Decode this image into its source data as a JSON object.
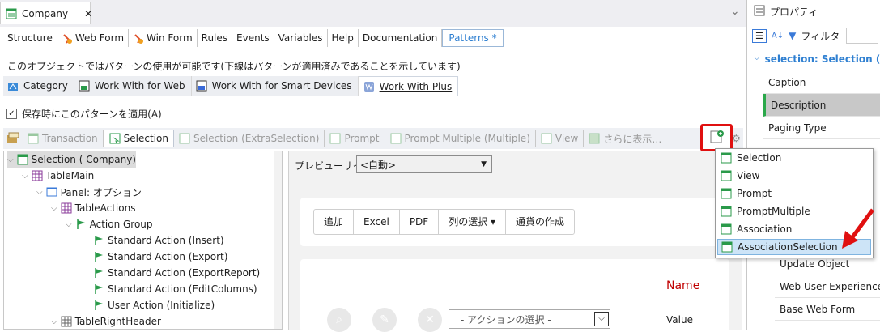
{
  "doc_tab": {
    "title": "Company",
    "close": "✕"
  },
  "top_menu": {
    "chevron": "⌄"
  },
  "tabs": [
    "Structure",
    "Web Form",
    "Win Form",
    "Rules",
    "Events",
    "Variables",
    "Help",
    "Documentation",
    "Patterns *"
  ],
  "info_text": "このオブジェクトではパターンの使用が可能です(下線はパターンが適用済みであることを示しています)",
  "pattern_tabs": [
    "Category",
    "Work With for Web",
    "Work With for Smart Devices",
    "Work With Plus"
  ],
  "apply_checkbox": {
    "label": "保存時にこのパターンを適用(A)",
    "checked": true
  },
  "instance_toolbar": [
    "Transaction",
    "Selection",
    "Selection (ExtraSelection)",
    "Prompt",
    "Prompt Multiple (Multiple)",
    "View",
    "さらに表示…"
  ],
  "tree": [
    {
      "label": "Selection ( Company)",
      "icon": "selection-icon",
      "depth": 0,
      "selected": true
    },
    {
      "label": "TableMain",
      "icon": "table-icon",
      "depth": 1
    },
    {
      "label": "Panel: オプション",
      "icon": "panel-icon",
      "depth": 2
    },
    {
      "label": "TableActions",
      "icon": "table-icon",
      "depth": 3
    },
    {
      "label": "Action Group",
      "icon": "flag-icon",
      "depth": 4
    },
    {
      "label": "Standard Action (Insert)",
      "icon": "flag-icon",
      "depth": 5
    },
    {
      "label": "Standard Action (Export)",
      "icon": "flag-icon",
      "depth": 5
    },
    {
      "label": "Standard Action (ExportReport)",
      "icon": "flag-icon",
      "depth": 5
    },
    {
      "label": "Standard Action (EditColumns)",
      "icon": "flag-icon",
      "depth": 5
    },
    {
      "label": "User Action (Initialize)",
      "icon": "flag-icon",
      "depth": 5
    },
    {
      "label": "TableRightHeader",
      "icon": "table-icon",
      "depth": 3
    }
  ],
  "preview": {
    "size_label": "プレビューサイズ",
    "size_value": "<自動>",
    "buttons": [
      "追加",
      "Excel",
      "PDF",
      "列の選択 ▾",
      "通貨の作成"
    ],
    "name_header": "Name",
    "action_select": "- アクションの選択 -",
    "value_label": "Value"
  },
  "add_menu": [
    "Selection",
    "View",
    "Prompt",
    "PromptMultiple",
    "Association",
    "AssociationSelection"
  ],
  "add_menu_highlighted": "AssociationSelection",
  "properties": {
    "title": "プロパティ",
    "filter_label": "フィルタ",
    "section": "selection: Selection (",
    "items": [
      "Caption",
      "Description",
      "Paging Type"
    ],
    "selected_item": "Description",
    "lower_items": [
      "Update Object",
      "Web User Experience",
      "Base Web Form"
    ]
  },
  "colors": {
    "accent": "#2e7fd1",
    "highlight_border": "#e01010",
    "name_red": "#c00000"
  }
}
